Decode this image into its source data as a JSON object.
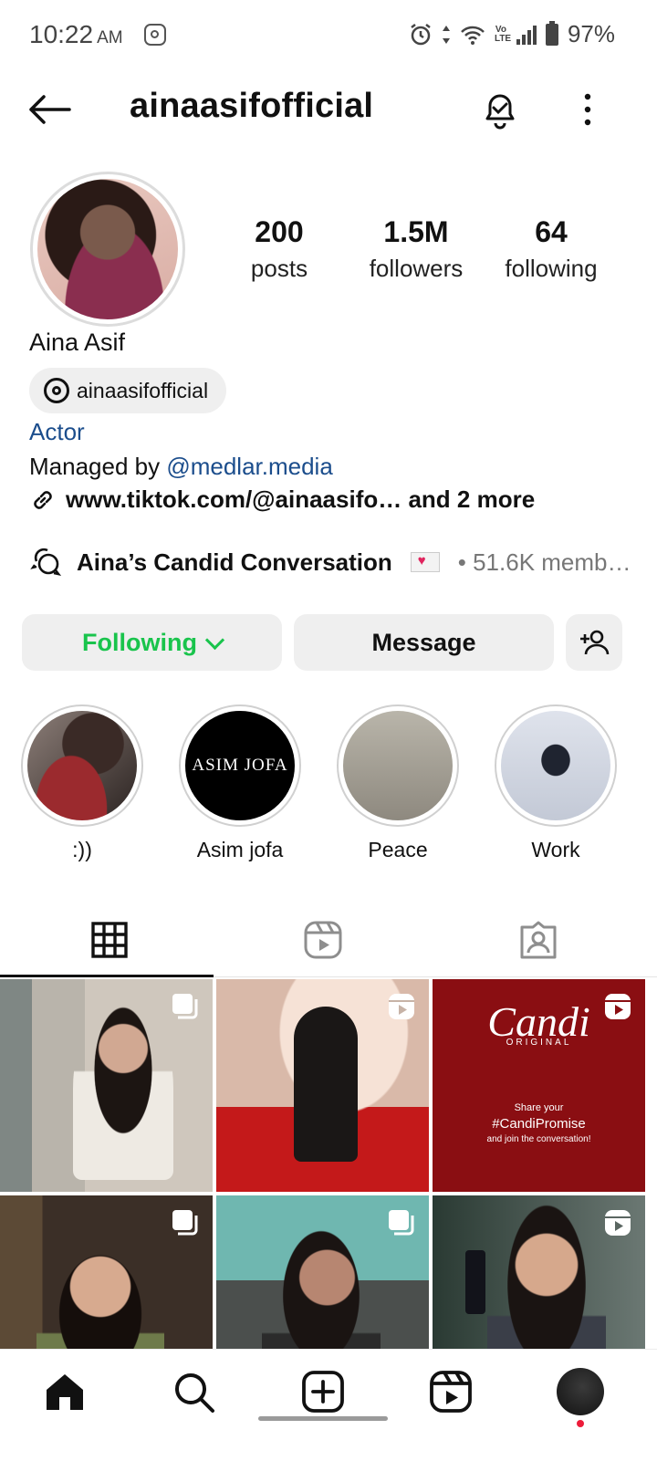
{
  "status_bar": {
    "time": "10:22",
    "ampm": "AM",
    "battery": "97%",
    "network_label": "Vo LTE"
  },
  "header": {
    "username": "ainaasifofficial"
  },
  "profile": {
    "full_name": "Aina Asif",
    "threads_handle": "ainaasifofficial",
    "category": "Actor",
    "managed_prefix": "Managed by ",
    "managed_mention": "@medlar.media",
    "link_text": "www.tiktok.com/@ainaasifo… and 2 more",
    "channel_name": "Aina’s Candid Conversation",
    "channel_members": "• 51.6K memb…"
  },
  "stats": [
    {
      "value": "200",
      "label": "posts"
    },
    {
      "value": "1.5M",
      "label": "followers"
    },
    {
      "value": "64",
      "label": "following"
    }
  ],
  "actions": {
    "following_label": "Following",
    "message_label": "Message"
  },
  "highlights": [
    {
      "label": ":))"
    },
    {
      "label": "Asim jofa",
      "cover_text": "ASIM JOFA"
    },
    {
      "label": "Peace"
    },
    {
      "label": "Work"
    }
  ],
  "tabs": [
    "grid-icon",
    "reels-icon",
    "tagged-icon"
  ],
  "grid_posts": [
    {
      "type": "carousel"
    },
    {
      "type": "reel"
    },
    {
      "type": "reel",
      "text": {
        "brand": "Candi",
        "sub": "ORIGINAL",
        "line1": "Share your",
        "hashtag": "#CandiPromise",
        "line2": "and join the conversation!"
      }
    },
    {
      "type": "carousel"
    },
    {
      "type": "carousel"
    },
    {
      "type": "reel"
    }
  ],
  "colors": {
    "following_green": "#19c44c",
    "link_blue": "#1b4d8c",
    "candi_red": "#8a0e12",
    "notification_dot": "#ed1c3a"
  }
}
